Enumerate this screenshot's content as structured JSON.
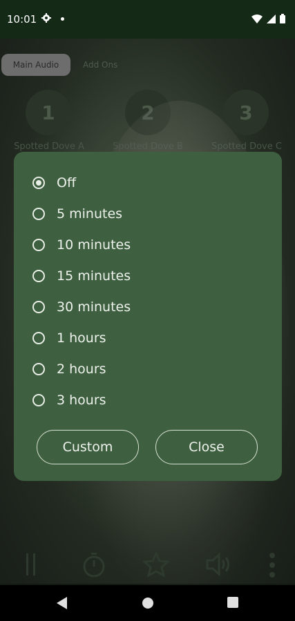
{
  "status": {
    "time": "10:01"
  },
  "tabs": {
    "main": "Main Audio",
    "addons": "Add Ons"
  },
  "sounds": [
    {
      "number": "1",
      "label": "Spotted Dove A"
    },
    {
      "number": "2",
      "label": "Spotted Dove B"
    },
    {
      "number": "3",
      "label": "Spotted Dove C"
    }
  ],
  "timer_dialog": {
    "options": [
      {
        "label": "Off",
        "selected": true
      },
      {
        "label": "5 minutes",
        "selected": false
      },
      {
        "label": "10 minutes",
        "selected": false
      },
      {
        "label": "15 minutes",
        "selected": false
      },
      {
        "label": "30 minutes",
        "selected": false
      },
      {
        "label": "1 hours",
        "selected": false
      },
      {
        "label": "2 hours",
        "selected": false
      },
      {
        "label": "3 hours",
        "selected": false
      }
    ],
    "custom_label": "Custom",
    "close_label": "Close"
  },
  "controls": [
    "pause-icon",
    "timer-icon",
    "star-icon",
    "volume-icon",
    "more-icon"
  ],
  "colors": {
    "dialog_bg": "#3e5f40",
    "status_bar": "#142a16"
  }
}
